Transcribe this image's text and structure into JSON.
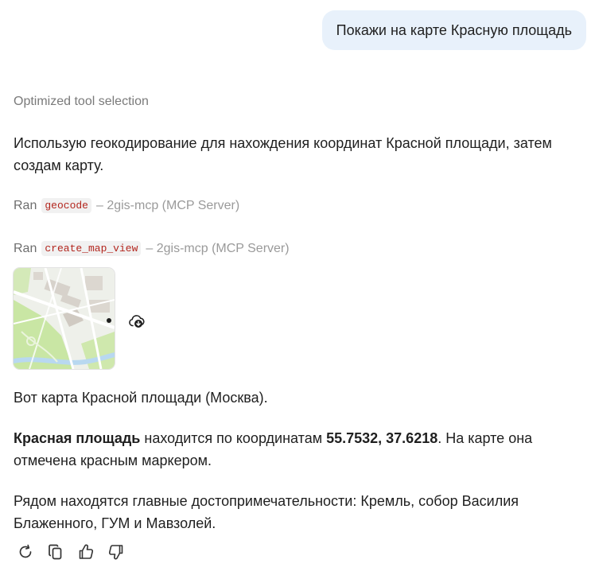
{
  "user_message": "Покажи на карте Красную площадь",
  "assistant": {
    "status": "Optimized tool selection",
    "intro": "Использую геокодирование для нахождения координат Красной площади, затем создам карту.",
    "tool_calls": [
      {
        "ran": "Ran",
        "tool": "geocode",
        "server": "– 2gis-mcp (MCP Server)"
      },
      {
        "ran": "Ran",
        "tool": "create_map_view",
        "server": "– 2gis-mcp (MCP Server)"
      }
    ],
    "map_caption": "Вот карта Красной площади (Москва).",
    "coords_para": {
      "place": "Красная площадь",
      "mid": " находится по координатам ",
      "coords": "55.7532, 37.6218",
      "tail": ". На карте она отмечена красным маркером."
    },
    "nearby": "Рядом находятся главные достопримечательности: Кремль, собор Василия Блаженного, ГУМ и Мавзолей."
  },
  "icons": {
    "download": "cloud-download-icon",
    "actions": [
      "retry-icon",
      "copy-icon",
      "thumbs-up-icon",
      "thumbs-down-icon"
    ]
  },
  "colors": {
    "user_bubble": "#e8f1fb",
    "code_text": "#b3261e",
    "code_bg": "#f1f1f1",
    "muted": "#7a7a7a",
    "map_park": "#c9e6a4",
    "map_road": "#ffffff"
  }
}
